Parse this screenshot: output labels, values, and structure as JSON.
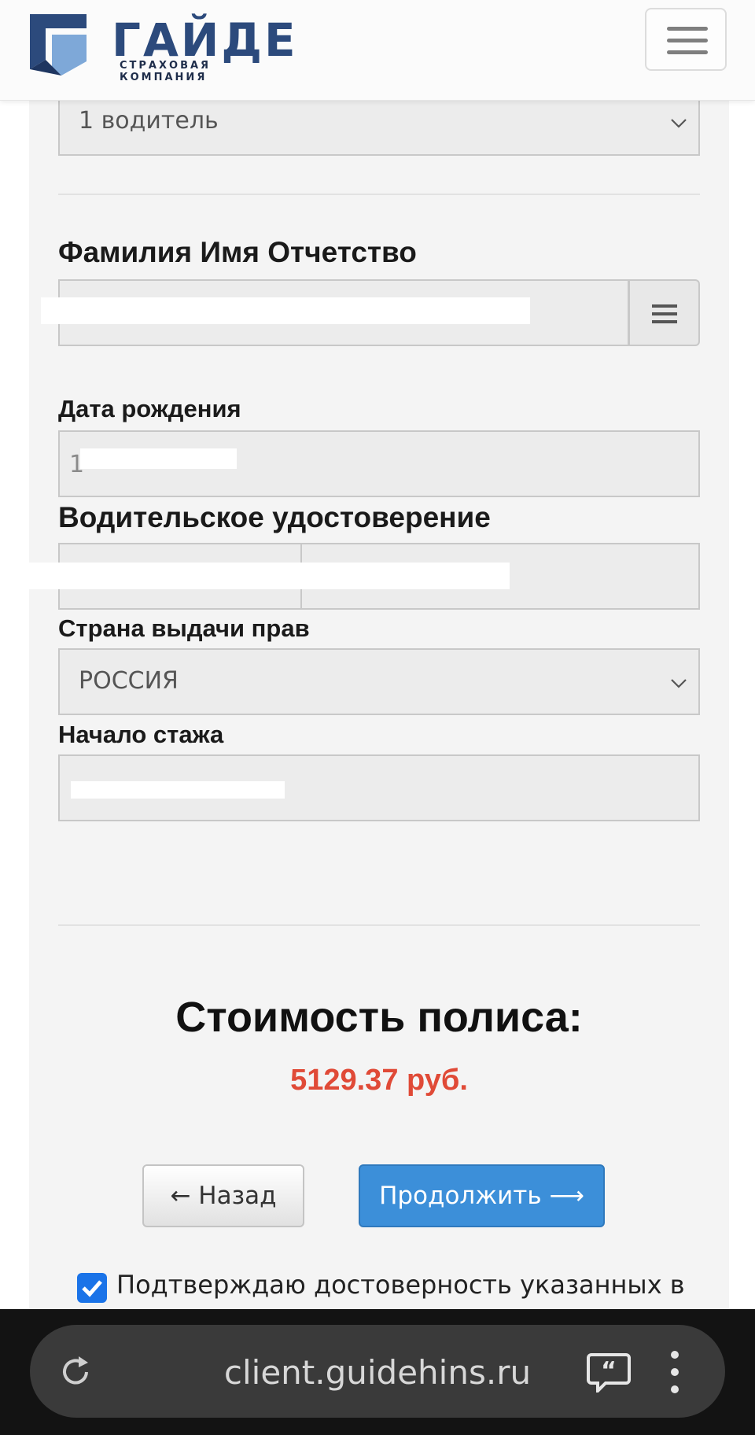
{
  "header": {
    "logo_word": "ГАЙДЕ",
    "logo_subtitle": "СТРАХОВАЯ КОМПАНИЯ",
    "menu_icon": "hamburger-menu-icon",
    "brand_color": "#2c4a7c"
  },
  "form": {
    "drivers_select_value": "1 водитель",
    "fio_label": "Фамилия Имя Отчетство",
    "fio_list_icon": "list-icon",
    "birth_label": "Дата рождения",
    "birth_value_partial": "1",
    "license_label": "Водительское удостоверение",
    "country_label": "Страна выдачи прав",
    "country_value": "РОССИЯ",
    "experience_label": "Начало стажа"
  },
  "price": {
    "title": "Стоимость полиса:",
    "value": "5129.37 руб.",
    "value_color": "#e04a37"
  },
  "buttons": {
    "back_label": "← Назад",
    "next_label": "Продолжить ⟶"
  },
  "consent": {
    "text": "Подтверждаю достоверность указанных в",
    "checked": true
  },
  "browser": {
    "url": "client.guidehins.ru",
    "reload_icon": "reload-icon",
    "quote_icon": "quote-bubble-icon",
    "menu_icon": "more-vert-icon"
  }
}
